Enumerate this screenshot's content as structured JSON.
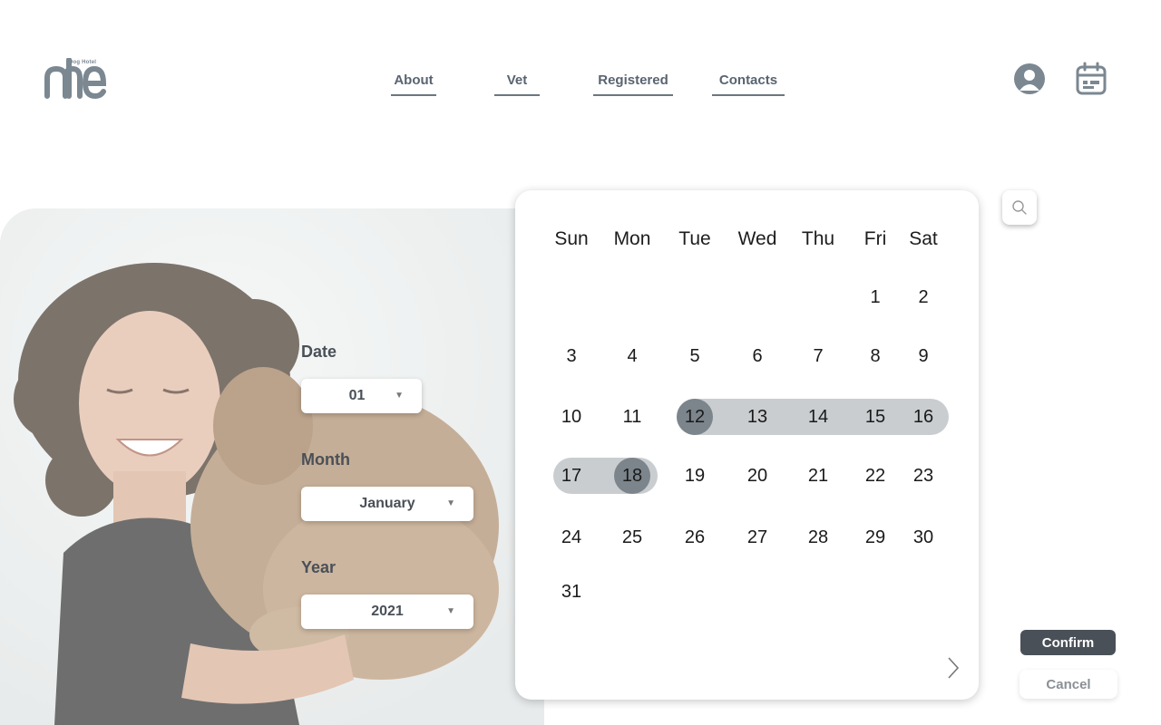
{
  "brand": {
    "logo_text": "me",
    "tagline": "Dog Hotel",
    "color": "#7b8791"
  },
  "nav": [
    {
      "label": "About"
    },
    {
      "label": "Vet"
    },
    {
      "label": "Registered"
    },
    {
      "label": "Contacts"
    }
  ],
  "header_icons": [
    "user-icon",
    "calendar-icon"
  ],
  "form": {
    "date": {
      "label": "Date",
      "value": "01"
    },
    "month": {
      "label": "Month",
      "value": "January"
    },
    "year": {
      "label": "Year",
      "value": "2021"
    }
  },
  "calendar": {
    "weekdays": [
      "Sun",
      "Mon",
      "Tue",
      "Wed",
      "Thu",
      "Fri",
      "Sat"
    ],
    "first_weekday_index": 5,
    "days_in_month": 31,
    "range_start": 12,
    "range_end": 18,
    "range_color": "#c9cdd0",
    "selected_color": "#7c858c"
  },
  "actions": {
    "confirm": "Confirm",
    "cancel": "Cancel"
  },
  "search_icon": "search-icon",
  "next_icon": "chevron-right-icon"
}
